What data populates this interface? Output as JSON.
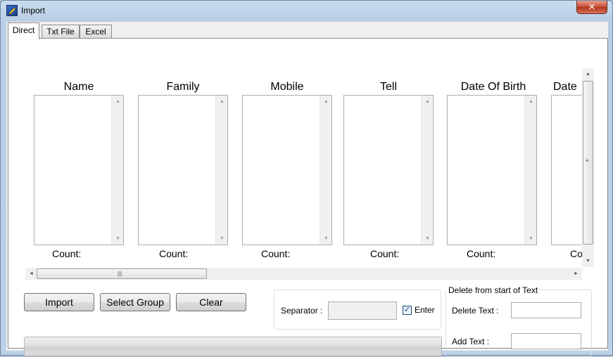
{
  "window": {
    "title": "Import",
    "close_symbol": "✕"
  },
  "tabs": [
    {
      "label": "Direct",
      "active": true
    },
    {
      "label": "Txt File",
      "active": false
    },
    {
      "label": "Excel",
      "active": false
    }
  ],
  "columns": [
    {
      "header": "Name",
      "count_label": "Count:"
    },
    {
      "header": "Family",
      "count_label": "Count:"
    },
    {
      "header": "Mobile",
      "count_label": "Count:"
    },
    {
      "header": "Tell",
      "count_label": "Count:"
    },
    {
      "header": "Date Of Birth",
      "count_label": "Count:"
    },
    {
      "header": "Date",
      "count_label": "Co"
    }
  ],
  "buttons": {
    "import": "Import",
    "select_group": "Select Group",
    "clear": "Clear"
  },
  "separator": {
    "label": "Separator :",
    "value": "",
    "enter_label": "Enter",
    "enter_checked": true
  },
  "delete_group": {
    "legend": "Delete from start of Text",
    "delete_text_label": "Delete Text :",
    "delete_text_value": "",
    "add_text_label": "Add Text :",
    "add_text_value": ""
  },
  "progress": {
    "value": 0
  },
  "icons": {
    "app": "import-app-icon",
    "up_arrow": "▲",
    "down_arrow": "▼",
    "left_arrow": "◄",
    "right_arrow": "►",
    "check": "✓",
    "grip_v": "≡",
    "grip_h": "|||"
  }
}
